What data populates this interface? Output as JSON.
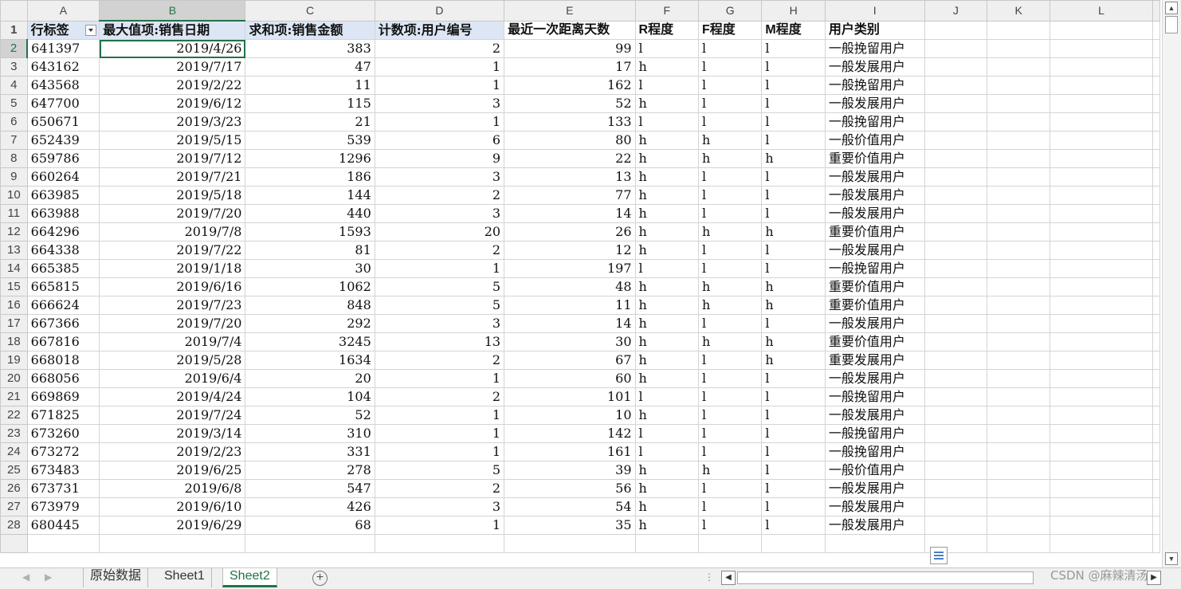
{
  "columns": [
    "A",
    "B",
    "C",
    "D",
    "E",
    "F",
    "G",
    "H",
    "I",
    "J",
    "K",
    "L"
  ],
  "header_row": {
    "row_num": "1",
    "cells": [
      "行标签",
      "最大值项:销售日期",
      "求和项:销售金额",
      "计数项:用户编号",
      "最近一次距离天数",
      "R程度",
      "F程度",
      "M程度",
      "用户类别",
      "",
      "",
      ""
    ]
  },
  "rows": [
    {
      "n": "2",
      "c": [
        "641397",
        "2019/4/26",
        "383",
        "2",
        "99",
        "l",
        "l",
        "l",
        "一般挽留用户"
      ]
    },
    {
      "n": "3",
      "c": [
        "643162",
        "2019/7/17",
        "47",
        "1",
        "17",
        "h",
        "l",
        "l",
        "一般发展用户"
      ]
    },
    {
      "n": "4",
      "c": [
        "643568",
        "2019/2/22",
        "11",
        "1",
        "162",
        "l",
        "l",
        "l",
        "一般挽留用户"
      ]
    },
    {
      "n": "5",
      "c": [
        "647700",
        "2019/6/12",
        "115",
        "3",
        "52",
        "h",
        "l",
        "l",
        "一般发展用户"
      ]
    },
    {
      "n": "6",
      "c": [
        "650671",
        "2019/3/23",
        "21",
        "1",
        "133",
        "l",
        "l",
        "l",
        "一般挽留用户"
      ]
    },
    {
      "n": "7",
      "c": [
        "652439",
        "2019/5/15",
        "539",
        "6",
        "80",
        "h",
        "h",
        "l",
        "一般价值用户"
      ]
    },
    {
      "n": "8",
      "c": [
        "659786",
        "2019/7/12",
        "1296",
        "9",
        "22",
        "h",
        "h",
        "h",
        "重要价值用户"
      ]
    },
    {
      "n": "9",
      "c": [
        "660264",
        "2019/7/21",
        "186",
        "3",
        "13",
        "h",
        "l",
        "l",
        "一般发展用户"
      ]
    },
    {
      "n": "10",
      "c": [
        "663985",
        "2019/5/18",
        "144",
        "2",
        "77",
        "h",
        "l",
        "l",
        "一般发展用户"
      ]
    },
    {
      "n": "11",
      "c": [
        "663988",
        "2019/7/20",
        "440",
        "3",
        "14",
        "h",
        "l",
        "l",
        "一般发展用户"
      ]
    },
    {
      "n": "12",
      "c": [
        "664296",
        "2019/7/8",
        "1593",
        "20",
        "26",
        "h",
        "h",
        "h",
        "重要价值用户"
      ]
    },
    {
      "n": "13",
      "c": [
        "664338",
        "2019/7/22",
        "81",
        "2",
        "12",
        "h",
        "l",
        "l",
        "一般发展用户"
      ]
    },
    {
      "n": "14",
      "c": [
        "665385",
        "2019/1/18",
        "30",
        "1",
        "197",
        "l",
        "l",
        "l",
        "一般挽留用户"
      ]
    },
    {
      "n": "15",
      "c": [
        "665815",
        "2019/6/16",
        "1062",
        "5",
        "48",
        "h",
        "h",
        "h",
        "重要价值用户"
      ]
    },
    {
      "n": "16",
      "c": [
        "666624",
        "2019/7/23",
        "848",
        "5",
        "11",
        "h",
        "h",
        "h",
        "重要价值用户"
      ]
    },
    {
      "n": "17",
      "c": [
        "667366",
        "2019/7/20",
        "292",
        "3",
        "14",
        "h",
        "l",
        "l",
        "一般发展用户"
      ]
    },
    {
      "n": "18",
      "c": [
        "667816",
        "2019/7/4",
        "3245",
        "13",
        "30",
        "h",
        "h",
        "h",
        "重要价值用户"
      ]
    },
    {
      "n": "19",
      "c": [
        "668018",
        "2019/5/28",
        "1634",
        "2",
        "67",
        "h",
        "l",
        "h",
        "重要发展用户"
      ]
    },
    {
      "n": "20",
      "c": [
        "668056",
        "2019/6/4",
        "20",
        "1",
        "60",
        "h",
        "l",
        "l",
        "一般发展用户"
      ]
    },
    {
      "n": "21",
      "c": [
        "669869",
        "2019/4/24",
        "104",
        "2",
        "101",
        "l",
        "l",
        "l",
        "一般挽留用户"
      ]
    },
    {
      "n": "22",
      "c": [
        "671825",
        "2019/7/24",
        "52",
        "1",
        "10",
        "h",
        "l",
        "l",
        "一般发展用户"
      ]
    },
    {
      "n": "23",
      "c": [
        "673260",
        "2019/3/14",
        "310",
        "1",
        "142",
        "l",
        "l",
        "l",
        "一般挽留用户"
      ]
    },
    {
      "n": "24",
      "c": [
        "673272",
        "2019/2/23",
        "331",
        "1",
        "161",
        "l",
        "l",
        "l",
        "一般挽留用户"
      ]
    },
    {
      "n": "25",
      "c": [
        "673483",
        "2019/6/25",
        "278",
        "5",
        "39",
        "h",
        "h",
        "l",
        "一般价值用户"
      ]
    },
    {
      "n": "26",
      "c": [
        "673731",
        "2019/6/8",
        "547",
        "2",
        "56",
        "h",
        "l",
        "l",
        "一般发展用户"
      ]
    },
    {
      "n": "27",
      "c": [
        "673979",
        "2019/6/10",
        "426",
        "3",
        "54",
        "h",
        "l",
        "l",
        "一般发展用户"
      ]
    },
    {
      "n": "28",
      "c": [
        "680445",
        "2019/6/29",
        "68",
        "1",
        "35",
        "h",
        "l",
        "l",
        "一般发展用户"
      ]
    }
  ],
  "sheet_tabs": [
    "原始数据",
    "Sheet1",
    "Sheet2"
  ],
  "active_tab": "Sheet2",
  "nav_icons": [
    "prev-sheet-icon",
    "next-sheet-icon"
  ],
  "add_sheet_label": "+",
  "watermark": "CSDN @麻辣清汤",
  "accent_color": "#217346",
  "pivot_header_color": "#dde6f4"
}
